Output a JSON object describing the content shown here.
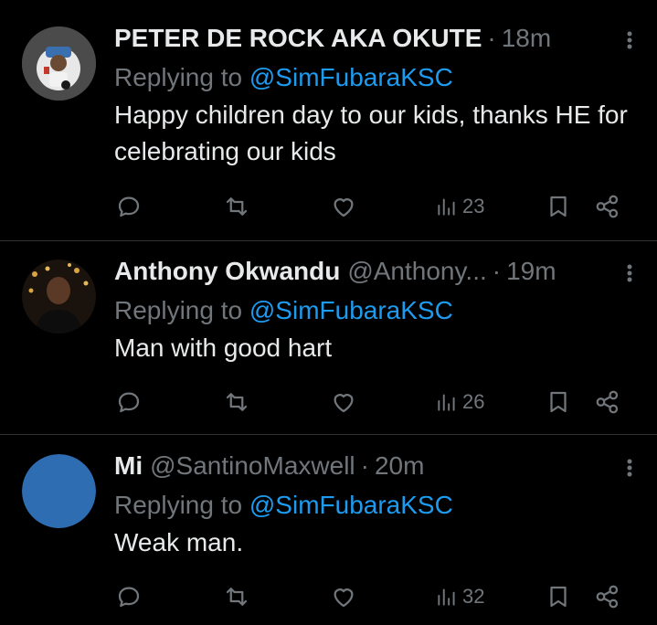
{
  "tweets": [
    {
      "name": "PETER DE ROCK AKA OKUTE",
      "handle": "",
      "time": "18m",
      "replying_prefix": "Replying to ",
      "replying_to": "@SimFubaraKSC",
      "text": "Happy children day to our kids, thanks HE for celebrating our kids",
      "views": "23",
      "avatar_icon": "profile-photo"
    },
    {
      "name": "Anthony Okwandu",
      "handle": "@Anthony...",
      "time": "19m",
      "replying_prefix": "Replying to ",
      "replying_to": "@SimFubaraKSC",
      "text": "Man with good hart",
      "views": "26",
      "avatar_icon": "profile-photo"
    },
    {
      "name": "Mi",
      "handle": "@SantinoMaxwell",
      "time": "20m",
      "replying_prefix": "Replying to ",
      "replying_to": "@SimFubaraKSC",
      "text": "Weak man.",
      "views": "32",
      "avatar_icon": "default-avatar",
      "avatar_color": "#2f6db2"
    }
  ],
  "separator": "·"
}
